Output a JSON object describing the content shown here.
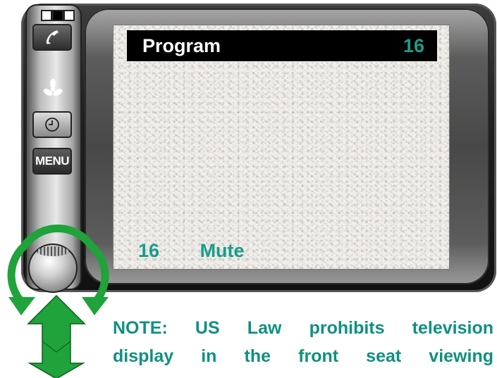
{
  "screen": {
    "title": "Program",
    "channel_top": "16",
    "channel_bottom": "16",
    "status": "Mute"
  },
  "buttons": {
    "phone_icon": "phone-icon",
    "fan_icon": "fan-icon",
    "clock_icon": "clock-icon",
    "menu_label": "MENU"
  },
  "knob": {
    "rotate_arrows_icon": "rotate-arrows-icon",
    "push_arrow_icon": "push-up-arrow-icon"
  },
  "note": {
    "line1": "NOTE: US Law prohibits television",
    "line2": "display in the front seat viewing"
  },
  "colors": {
    "accent": "#1a9d8a",
    "arrow_green": "#1fa33a",
    "title_bar": "#000000"
  }
}
